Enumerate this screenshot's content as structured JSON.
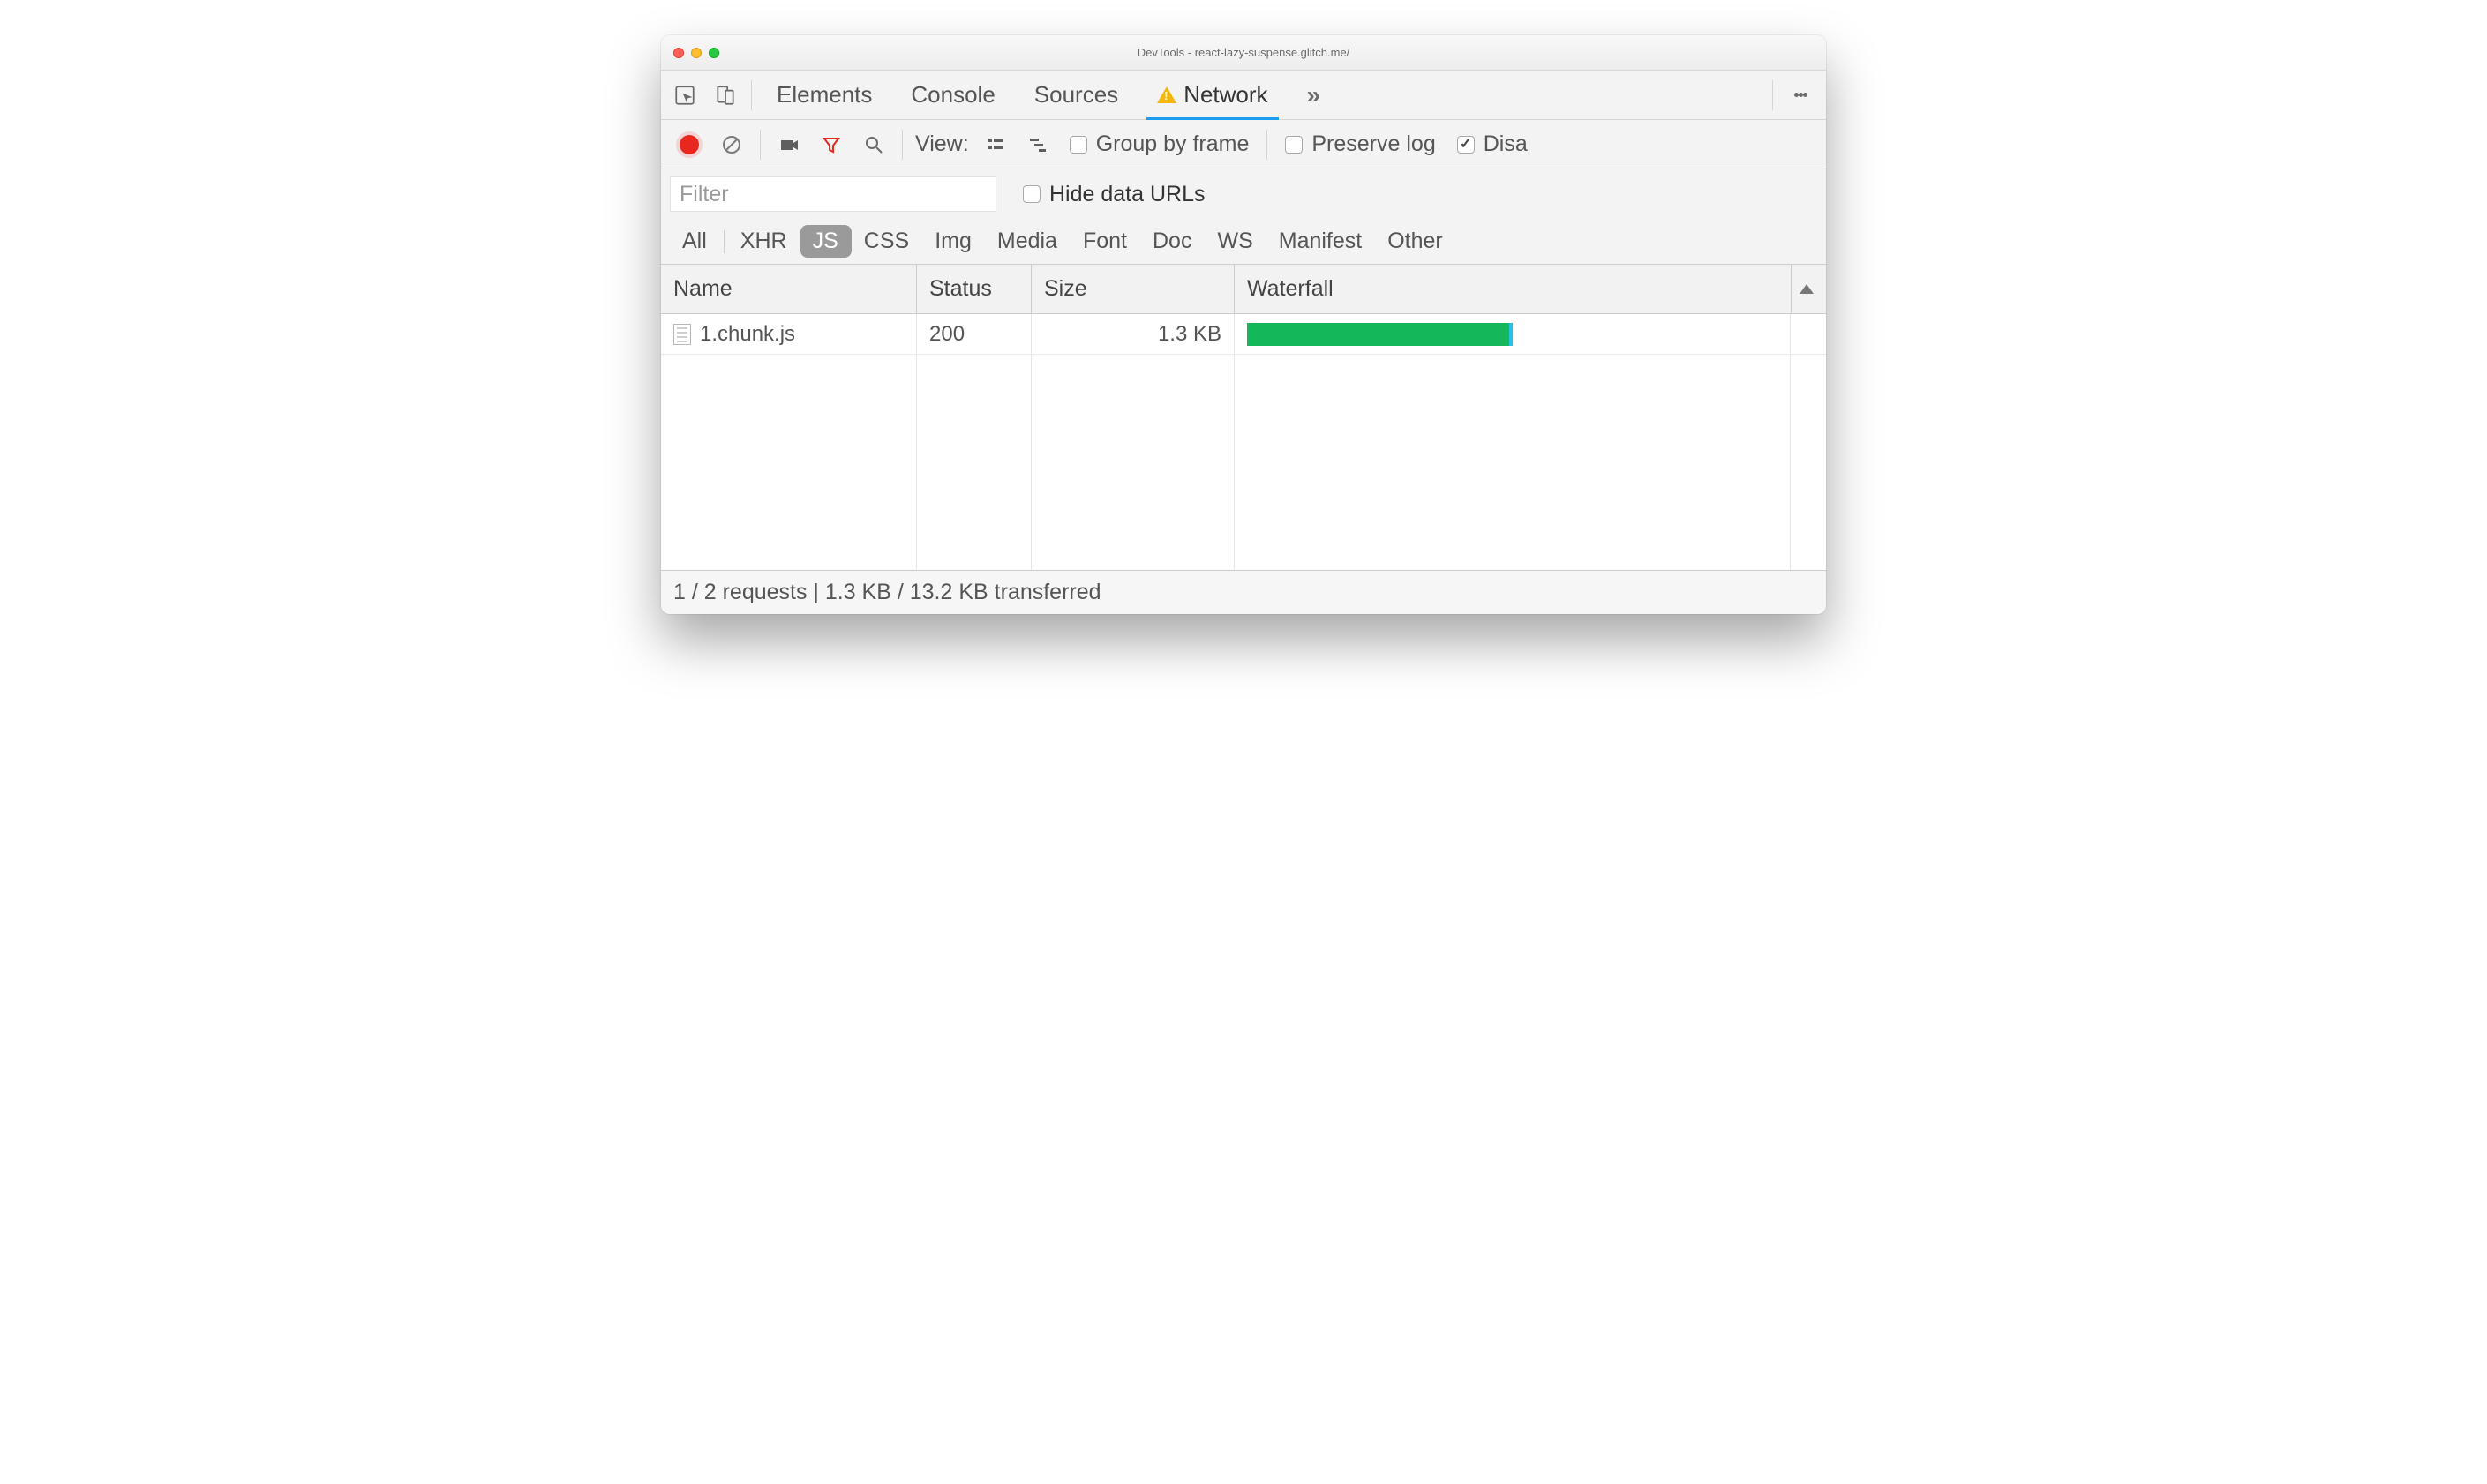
{
  "window": {
    "title": "DevTools - react-lazy-suspense.glitch.me/"
  },
  "tabs": {
    "items": [
      "Elements",
      "Console",
      "Sources",
      "Network"
    ],
    "active": "Network",
    "has_warning_on": "Network"
  },
  "toolbar": {
    "view_label": "View:",
    "group_by_frame": {
      "label": "Group by frame",
      "checked": false
    },
    "preserve_log": {
      "label": "Preserve log",
      "checked": false
    },
    "disable_cache": {
      "label": "Disa",
      "checked": true
    }
  },
  "filter": {
    "placeholder": "Filter",
    "hide_data_urls": {
      "label": "Hide data URLs",
      "checked": false
    }
  },
  "types": {
    "items": [
      "All",
      "XHR",
      "JS",
      "CSS",
      "Img",
      "Media",
      "Font",
      "Doc",
      "WS",
      "Manifest",
      "Other"
    ],
    "active": "JS"
  },
  "table": {
    "columns": [
      "Name",
      "Status",
      "Size",
      "Waterfall"
    ],
    "rows": [
      {
        "name": "1.chunk.js",
        "status": "200",
        "size": "1.3 KB",
        "waterfall_pct": 50
      }
    ]
  },
  "status_bar": "1 / 2 requests | 1.3 KB / 13.2 KB transferred"
}
